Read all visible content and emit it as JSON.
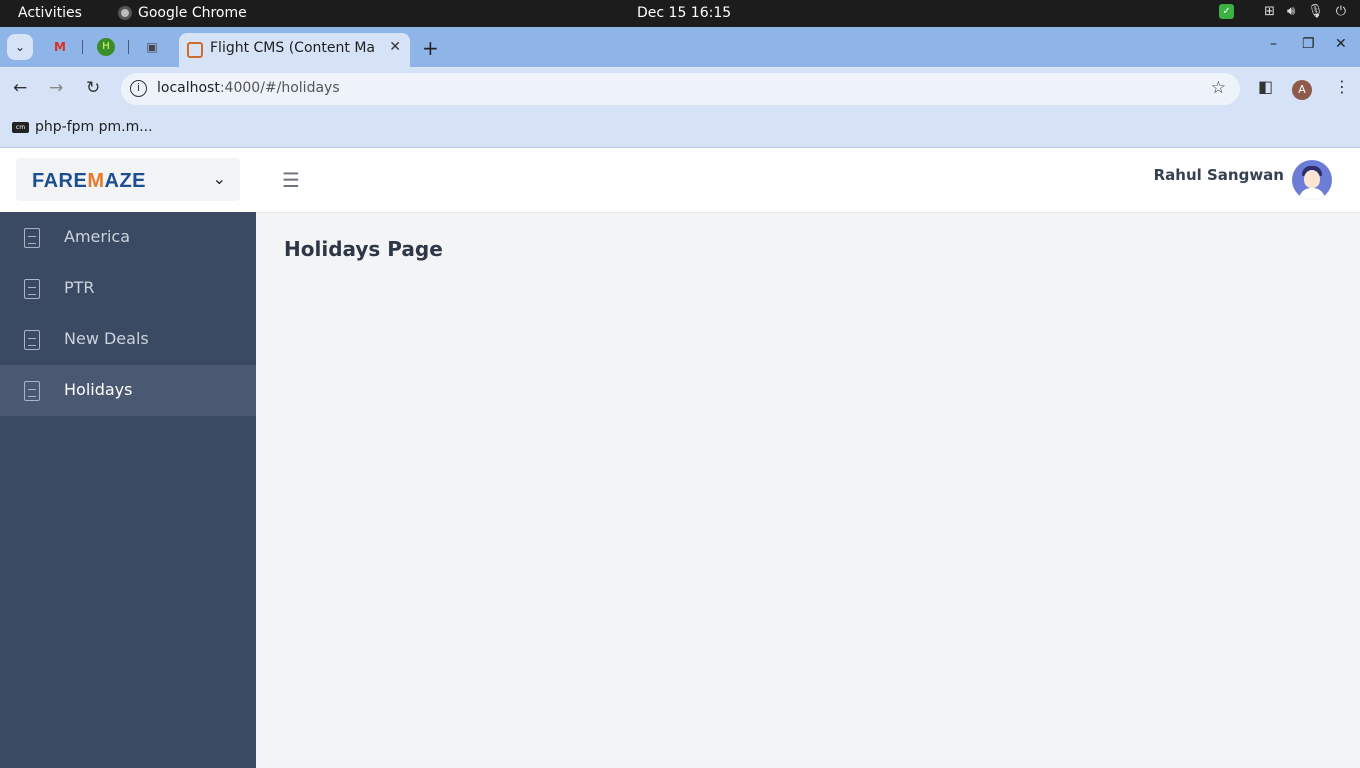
{
  "system_bar": {
    "activities": "Activities",
    "app_name": "Google Chrome",
    "clock": "Dec 15  16:15"
  },
  "browser": {
    "active_tab_title": "Flight CMS (Content Mar",
    "url_host": "localhost",
    "url_rest": ":4000/#/holidays",
    "profile_initial": "A",
    "bookmark_label": "php-fpm pm.m...",
    "bookmark_icon_text": "cm"
  },
  "app": {
    "brand": {
      "logo_text_a": "FARE",
      "logo_text_b": "M",
      "logo_text_c": "AZE"
    },
    "user_name": "Rahul Sangwan",
    "sidebar": {
      "items": [
        {
          "label": "America"
        },
        {
          "label": "PTR"
        },
        {
          "label": "New Deals"
        },
        {
          "label": "Holidays"
        }
      ]
    },
    "page_title": "Holidays Page"
  }
}
